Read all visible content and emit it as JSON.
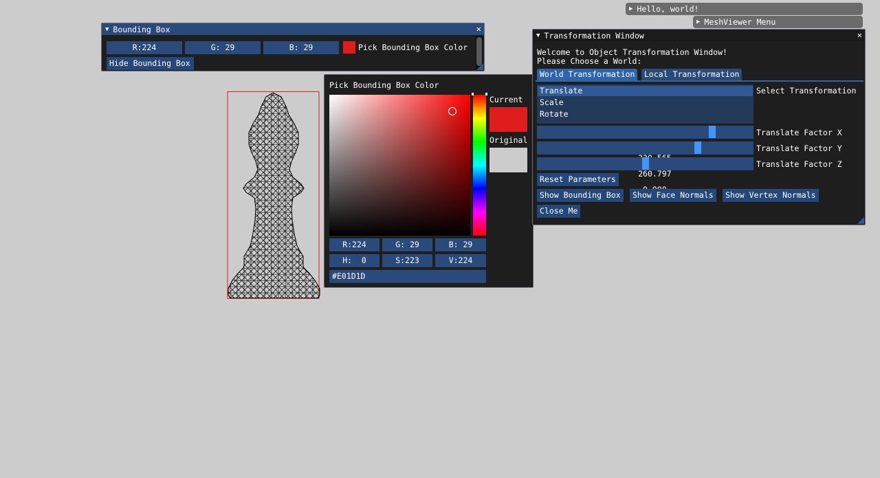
{
  "top_buttons": {
    "hello": "Hello, world!",
    "meshviewer": "MeshViewer Menu"
  },
  "bbox_window": {
    "title": "Bounding Box",
    "r": "R:224",
    "g": "G: 29",
    "b": "B: 29",
    "pick_label": "Pick Bounding Box Color",
    "hide_button": "Hide Bounding Box"
  },
  "color_picker": {
    "title": "Pick Bounding Box Color",
    "current_label": "Current",
    "original_label": "Original",
    "r": "R:224",
    "g": "G: 29",
    "b": "B: 29",
    "h": "H:  0",
    "s": "S:223",
    "v": "V:224",
    "hex": "#E01D1D",
    "current_color": "#E01D1D",
    "original_color": "#CCCCCC"
  },
  "transform_window": {
    "title": "Transformation Window",
    "welcome": "Welcome to Object Transformation Window!",
    "choose": "Please Choose a World:",
    "tabs": [
      "World Transformation",
      "Local Transformation"
    ],
    "list": [
      "Translate",
      "Scale",
      "Rotate"
    ],
    "list_label": "Select Transformation",
    "sliders": [
      {
        "value": "330.565",
        "label": "Translate Factor X",
        "fraction": 0.82
      },
      {
        "value": "260.797",
        "label": "Translate Factor Y",
        "fraction": 0.75
      },
      {
        "value": "0.000",
        "label": "Translate Factor Z",
        "fraction": 0.5
      }
    ],
    "reset": "Reset Parameters",
    "show_bbox": "Show Bounding Box",
    "show_face": "Show Face Normals",
    "show_vertex": "Show Vertex Normals",
    "close": "Close Me"
  },
  "colors": {
    "background": "#CCCCCC",
    "bbox_line": "#E01D1D",
    "accent": "#4296FA",
    "titlebar": "#294A7A"
  }
}
